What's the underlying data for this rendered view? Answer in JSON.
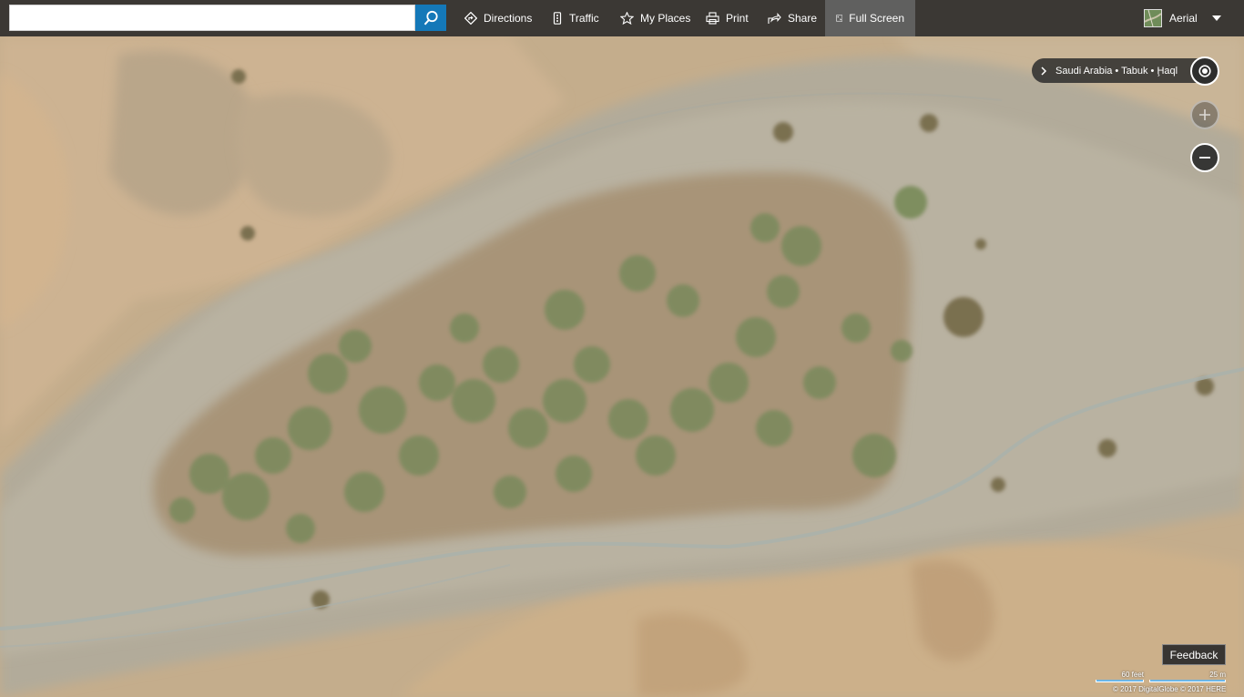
{
  "toolbar": {
    "search": {
      "value": "",
      "placeholder": ""
    },
    "search_button_icon": "search-icon",
    "tools": [
      {
        "label": "Directions",
        "icon": "directions-icon"
      },
      {
        "label": "Traffic",
        "icon": "traffic-icon"
      },
      {
        "label": "My Places",
        "icon": "star-icon"
      },
      {
        "label": "Print",
        "icon": "print-icon"
      },
      {
        "label": "Share",
        "icon": "share-icon"
      },
      {
        "label": "Full Screen",
        "icon": "fullscreen-icon",
        "active": true
      }
    ],
    "map_style": {
      "label": "Aerial",
      "icon": "aerial-thumbnail-icon"
    }
  },
  "breadcrumb": {
    "text": "Saudi Arabia • Tabuk • Ḩaql",
    "expand_icon": "chevron-right-icon"
  },
  "controls": {
    "locate_icon": "locate-me-icon",
    "zoom_in_icon": "plus-icon",
    "zoom_out_icon": "minus-icon"
  },
  "feedback": {
    "label": "Feedback"
  },
  "scale": {
    "imperial": "60 feet",
    "metric": "25 m"
  },
  "copyright": "© 2017 DigitalGlobe © 2017 HERE",
  "colors": {
    "toolbar_bg": "#282828",
    "search_button": "#1478b8",
    "scale_bar": "#6bb5e6"
  }
}
